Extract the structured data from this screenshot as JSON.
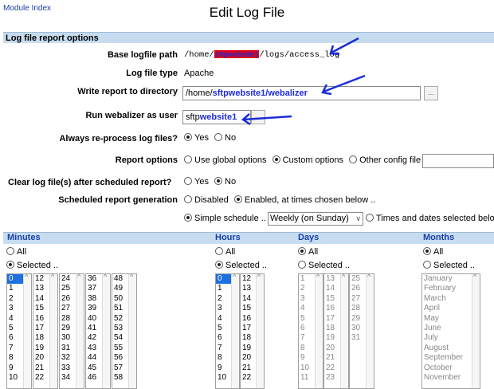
{
  "header": {
    "module_index": "Module Index",
    "title": "Edit Log File"
  },
  "section": {
    "title": "Log file report options"
  },
  "fields": {
    "base_logfile": {
      "label": "Base logfile path",
      "prefix": "/home/",
      "redacted": "sftpwebsite1",
      "suffix": "/logs/access_log"
    },
    "logfile_type": {
      "label": "Log file type",
      "value": "Apache"
    },
    "write_dir": {
      "label": "Write report to directory",
      "prefix": "/home/",
      "bold": "sftpwebsite1/webalizer"
    },
    "run_as": {
      "label": "Run webalizer as user",
      "prefix": "sftp",
      "bold": "website1"
    },
    "reprocess": {
      "label": "Always re-process log files?",
      "yes": "Yes",
      "no": "No"
    },
    "report_options": {
      "label": "Report options",
      "opt1": "Use global options",
      "opt2": "Custom options",
      "opt3": "Other config file .."
    },
    "clear_logs": {
      "label": "Clear log file(s) after scheduled report?",
      "yes": "Yes",
      "no": "No"
    },
    "scheduled": {
      "label": "Scheduled report generation",
      "opt1": "Disabled",
      "opt2": "Enabled, at times chosen below .."
    },
    "schedule_type": {
      "simple": "Simple schedule ..",
      "select_value": "Weekly (on Sunday)",
      "times": "Times and dates selected below .."
    }
  },
  "schedule": {
    "minutes": {
      "title": "Minutes",
      "all": "All",
      "selected": "Selected ..",
      "cols": [
        [
          "0",
          "1",
          "2",
          "3",
          "4",
          "5",
          "6",
          "7",
          "8",
          "9",
          "10"
        ],
        [
          "12",
          "13",
          "14",
          "15",
          "16",
          "17",
          "18",
          "19",
          "20",
          "21",
          "22"
        ],
        [
          "24",
          "25",
          "26",
          "27",
          "28",
          "29",
          "30",
          "31",
          "32",
          "33",
          "34"
        ],
        [
          "36",
          "37",
          "38",
          "39",
          "40",
          "41",
          "42",
          "43",
          "44",
          "45",
          "46"
        ],
        [
          "48",
          "49",
          "50",
          "51",
          "52",
          "53",
          "54",
          "55",
          "56",
          "57",
          "58"
        ]
      ]
    },
    "hours": {
      "title": "Hours",
      "all": "All",
      "selected": "Selected ..",
      "cols": [
        [
          "0",
          "1",
          "2",
          "3",
          "4",
          "5",
          "6",
          "7",
          "8",
          "9",
          "10"
        ],
        [
          "12",
          "13",
          "14",
          "15",
          "16",
          "17",
          "18",
          "19",
          "20",
          "21",
          "22"
        ]
      ]
    },
    "days": {
      "title": "Days",
      "all": "All",
      "selected": "Selected ..",
      "cols": [
        [
          "1",
          "2",
          "3",
          "4",
          "5",
          "6",
          "7",
          "8",
          "9",
          "10",
          "11"
        ],
        [
          "13",
          "14",
          "15",
          "16",
          "17",
          "18",
          "19",
          "20",
          "21",
          "22",
          "23"
        ],
        [
          "25",
          "26",
          "27",
          "28",
          "29",
          "30",
          "31"
        ]
      ]
    },
    "months": {
      "title": "Months",
      "all": "All",
      "selected": "Selected ..",
      "items": [
        "January",
        "February",
        "March",
        "April",
        "May",
        "June",
        "July",
        "August",
        "September",
        "October",
        "November"
      ]
    }
  },
  "colors": {
    "section_bg": "#c7ddef",
    "selected_item": "#1e6fe0",
    "annotation_arrow": "#1c2cd6",
    "redaction": "#e00018"
  }
}
